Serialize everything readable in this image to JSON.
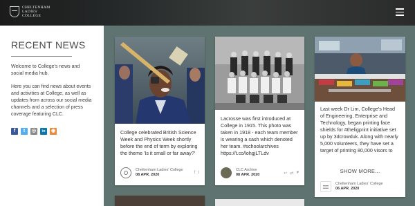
{
  "header": {
    "logo_lines": [
      "CHELTENHAM",
      "LADIES'",
      "COLLEGE"
    ]
  },
  "sidebar": {
    "title": "RECENT NEWS",
    "intro": "Welcome to College's news and social media hub.",
    "body": "Here you can find news about events and activities at College, as well as updates from across our social media channels and a selection of press coverage featuring CLC.",
    "social": [
      {
        "icon": "facebook-icon",
        "glyph": "f",
        "color": "#3b5998"
      },
      {
        "icon": "twitter-icon",
        "glyph": "t",
        "color": "#55acee"
      },
      {
        "icon": "instagram-icon",
        "glyph": "◎",
        "color": "#8a8a8a"
      },
      {
        "icon": "linkedin-icon",
        "glyph": "in",
        "color": "#0e76a8"
      },
      {
        "icon": "rss-icon",
        "glyph": "◉",
        "color": "#e98a3c"
      }
    ]
  },
  "posts": [
    {
      "text": "College celebrated British Science Week and Physics Week shortly before the end of term by exploring the theme 'Is it small or far away?'",
      "author": "Cheltenham Ladies' College",
      "date": "08 APR. 2020",
      "source_icon": "instagram-icon"
    },
    {
      "text": "Lacrosse was first introduced at College in 1915. This photo was taken in 1918 - each team member is wearing a sash which denoted her team. #schoolarchives https://t.co/lohgjLTLdv",
      "author": "CLC Archive",
      "date": "08 APR. 2020",
      "source_icon": "twitter-icon"
    },
    {
      "text": "Last week Dr Lim, College's Head of Engineering, Enterprise and Technology, began printing face shields for #theligprint initiative set up by 3dcrowduk. Along with nearly 5,000 volunteers, they have set a target of printing 80,000 visors to",
      "author": "Cheltenham Ladies' College",
      "date": "06 APR. 2020",
      "show_more": "SHOW MORE...",
      "source_icon": "linkedin-icon"
    }
  ]
}
